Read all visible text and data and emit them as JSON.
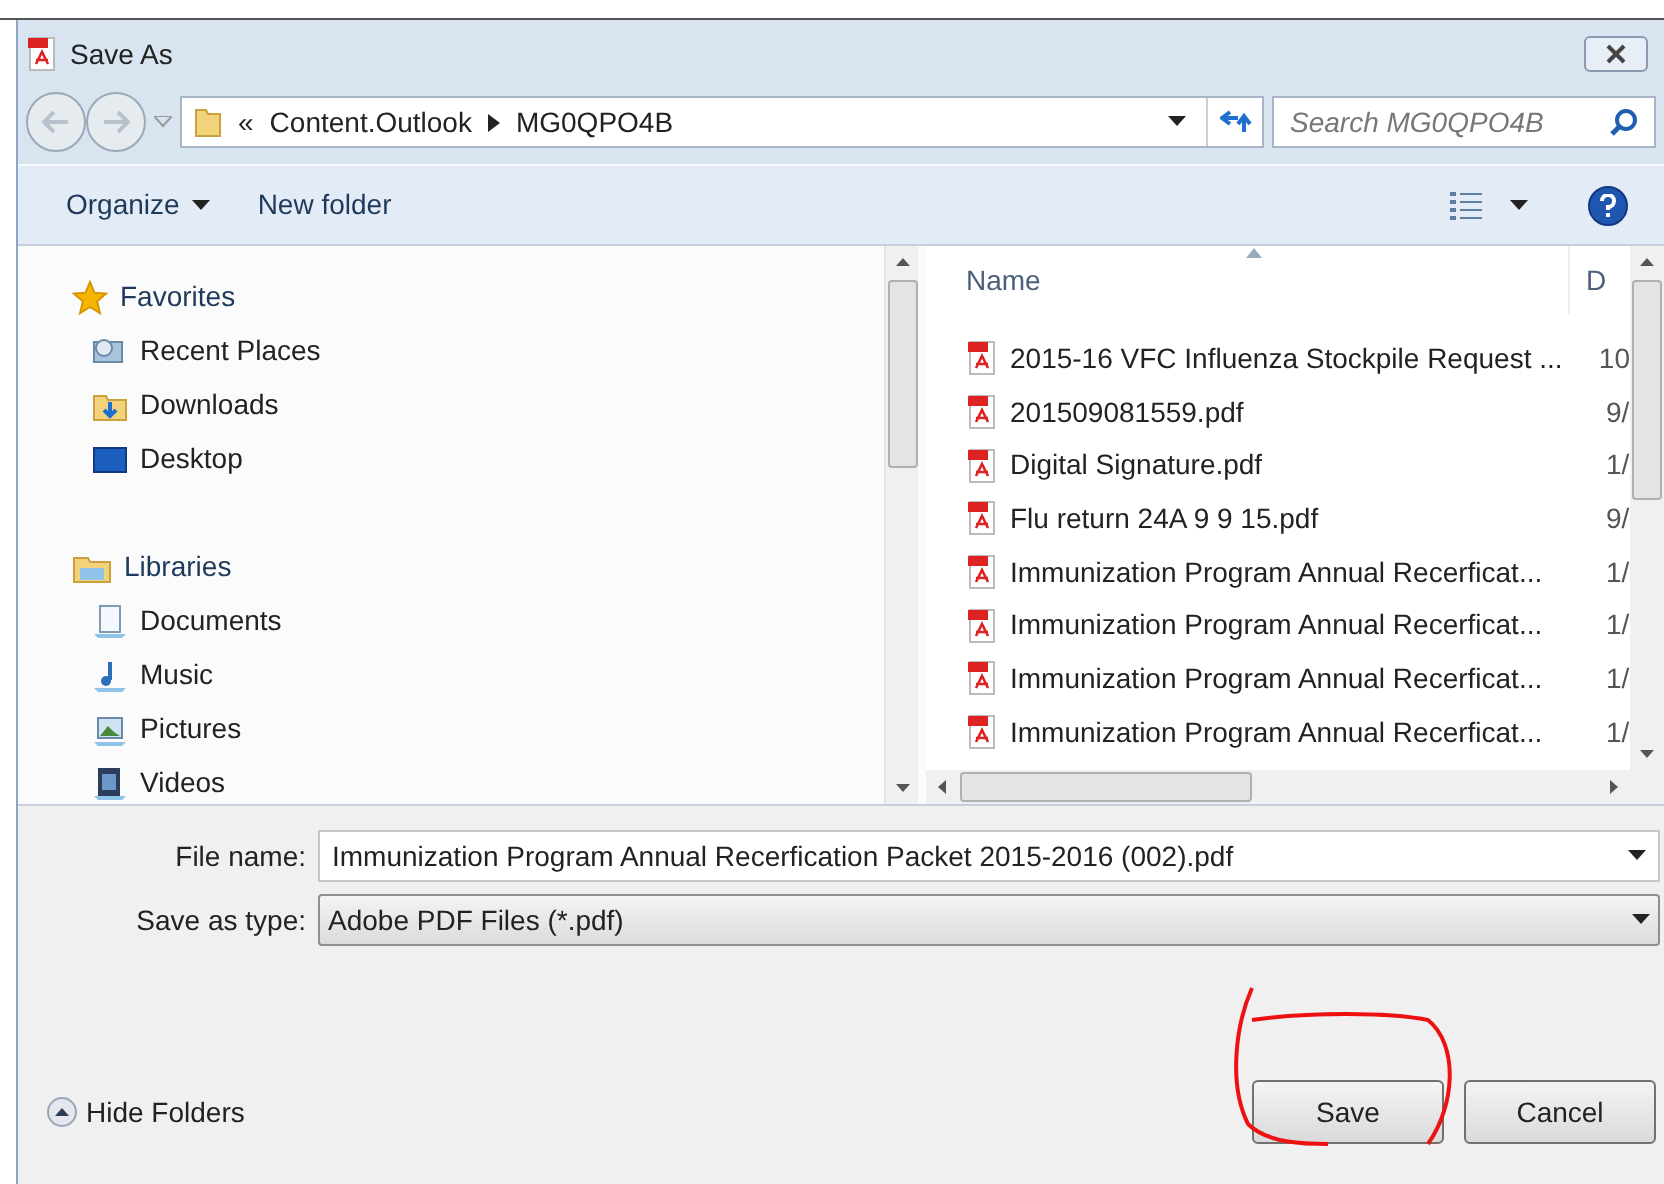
{
  "window": {
    "title": "Save As"
  },
  "address_bar": {
    "overflow": "«",
    "crumbs": [
      "Content.Outlook",
      "MG0QPO4B"
    ]
  },
  "search": {
    "placeholder": "Search MG0QPO4B"
  },
  "toolbar": {
    "organize": "Organize",
    "new_folder": "New folder"
  },
  "sidebar": {
    "groups": [
      {
        "label": "Favorites",
        "children": [
          {
            "label": "Recent Places"
          },
          {
            "label": "Downloads"
          },
          {
            "label": "Desktop"
          }
        ]
      },
      {
        "label": "Libraries",
        "children": [
          {
            "label": "Documents"
          },
          {
            "label": "Music"
          },
          {
            "label": "Pictures"
          },
          {
            "label": "Videos"
          }
        ]
      }
    ]
  },
  "file_list": {
    "columns": [
      "Name",
      "D"
    ],
    "rows": [
      {
        "name": "2015-16 VFC Influenza Stockpile Request ...",
        "column_2": "10"
      },
      {
        "name": "201509081559.pdf",
        "column_2": "9/"
      },
      {
        "name": "Digital Signature.pdf",
        "column_2": "1/"
      },
      {
        "name": "Flu return 24A 9 9 15.pdf",
        "column_2": "9/"
      },
      {
        "name": "Immunization Program Annual Recerficat...",
        "column_2": "1/"
      },
      {
        "name": "Immunization Program Annual Recerficat...",
        "column_2": "1/"
      },
      {
        "name": "Immunization Program Annual Recerficat...",
        "column_2": "1/"
      },
      {
        "name": "Immunization Program Annual Recerficat...",
        "column_2": "1/"
      }
    ]
  },
  "file_name": {
    "label": "File name:",
    "value": "Immunization Program Annual Recerfication Packet 2015-2016 (002).pdf"
  },
  "save_as_type": {
    "label": "Save as type:",
    "value": "Adobe PDF Files (*.pdf)"
  },
  "hide_folders": "Hide Folders",
  "buttons": [
    {
      "label": "Save",
      "circled": true
    },
    {
      "label": "Cancel",
      "circled": false
    }
  ]
}
